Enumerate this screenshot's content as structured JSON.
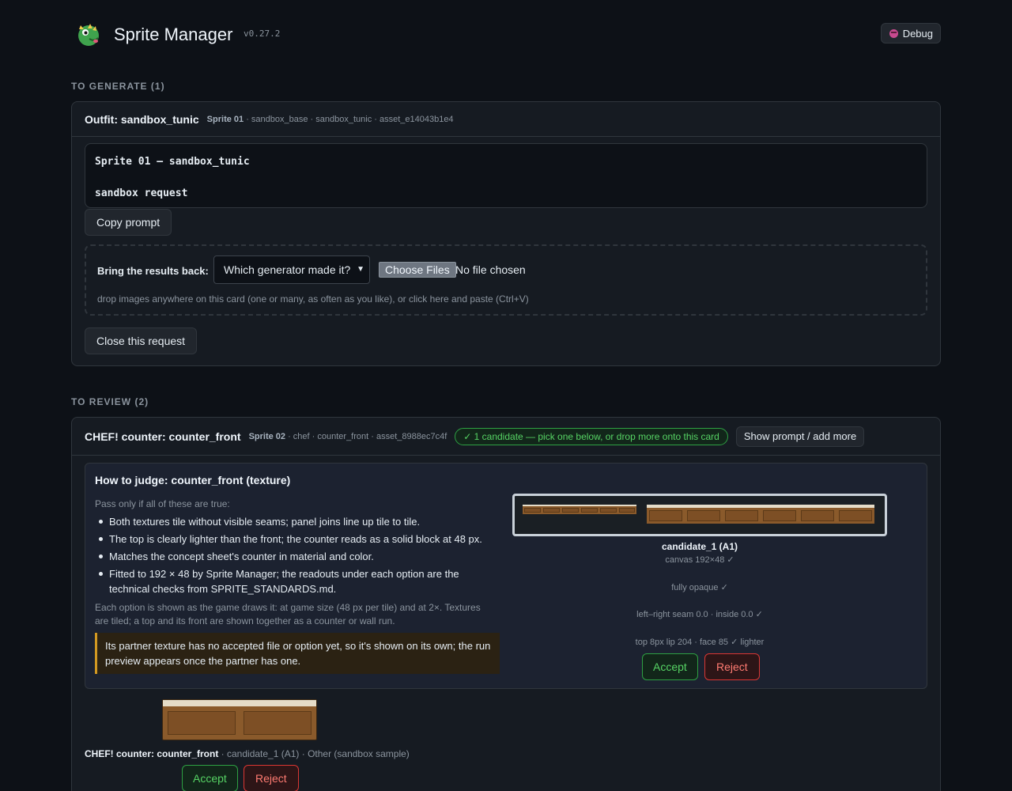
{
  "app": {
    "title": "Sprite Manager",
    "version": "v0.27.2",
    "debug_label": "Debug",
    "logo_icon": "dragon-logo-icon"
  },
  "to_generate": {
    "section_label": "TO GENERATE (1)",
    "card": {
      "title": "Outfit: sandbox_tunic",
      "sprite": "Sprite 01",
      "meta": " · sandbox_base · sandbox_tunic · asset_e14043b1e4",
      "prompt_line1": "Sprite 01 — sandbox_tunic",
      "prompt_line2": "sandbox request",
      "copy_label": "Copy prompt",
      "bring_back_label": "Bring the results back:",
      "generator_select_value": "Which generator made it?",
      "choose_files_label": "Choose Files",
      "file_status": "No file chosen",
      "drop_hint": "drop images anywhere on this card (one or many, as often as you like), or click here and paste (Ctrl+V)",
      "close_label": "Close this request"
    }
  },
  "to_review": {
    "section_label": "TO REVIEW (2)",
    "card": {
      "title": "CHEF! counter: counter_front",
      "sprite": "Sprite 02",
      "meta": " · chef · counter_front · asset_8988ec7c4f",
      "badge": "✓ 1 candidate — pick one below, or drop more onto this card",
      "show_prompt_label": "Show prompt / add more",
      "judge": {
        "title": "How to judge: counter_front (texture)",
        "intro": "Pass only if all of these are true:",
        "criteria": [
          "Both textures tile without visible seams; panel joins line up tile to tile.",
          "The top is clearly lighter than the front; the counter reads as a solid block at 48 px.",
          "Matches the concept sheet's counter in material and color.",
          "Fitted to 192 × 48 by Sprite Manager; the readouts under each option are the technical checks from SPRITE_STANDARDS.md."
        ],
        "note": "Each option is shown as the game draws it: at game size (48 px per tile) and at 2×. Textures are tiled; a top and its front are shown together as a counter or wall run.",
        "warning": "Its partner texture has no accepted file or option yet, so it's shown on its own; the run preview appears once the partner has one."
      },
      "candidate": {
        "name": "candidate_1 (A1)",
        "checks": [
          "canvas 192×48 ✓",
          "fully opaque ✓",
          "left–right seam 0.0 · inside 0.0 ✓",
          "top 8px lip 204 · face 85 ✓ lighter"
        ],
        "accept_label": "Accept",
        "reject_label": "Reject"
      },
      "run": {
        "title": "CHEF! counter: counter_front",
        "detail": " · candidate_1 (A1) · Other (sandbox sample)",
        "accept_label": "Accept",
        "reject_label": "Reject"
      }
    }
  },
  "colors": {
    "background": "#0d1117",
    "card": "#161b22",
    "accept": "#56d364",
    "reject": "#ff7b72",
    "warning": "#d29922",
    "texture_wood": "#8a5a2b",
    "texture_top": "#e5dcc8"
  }
}
